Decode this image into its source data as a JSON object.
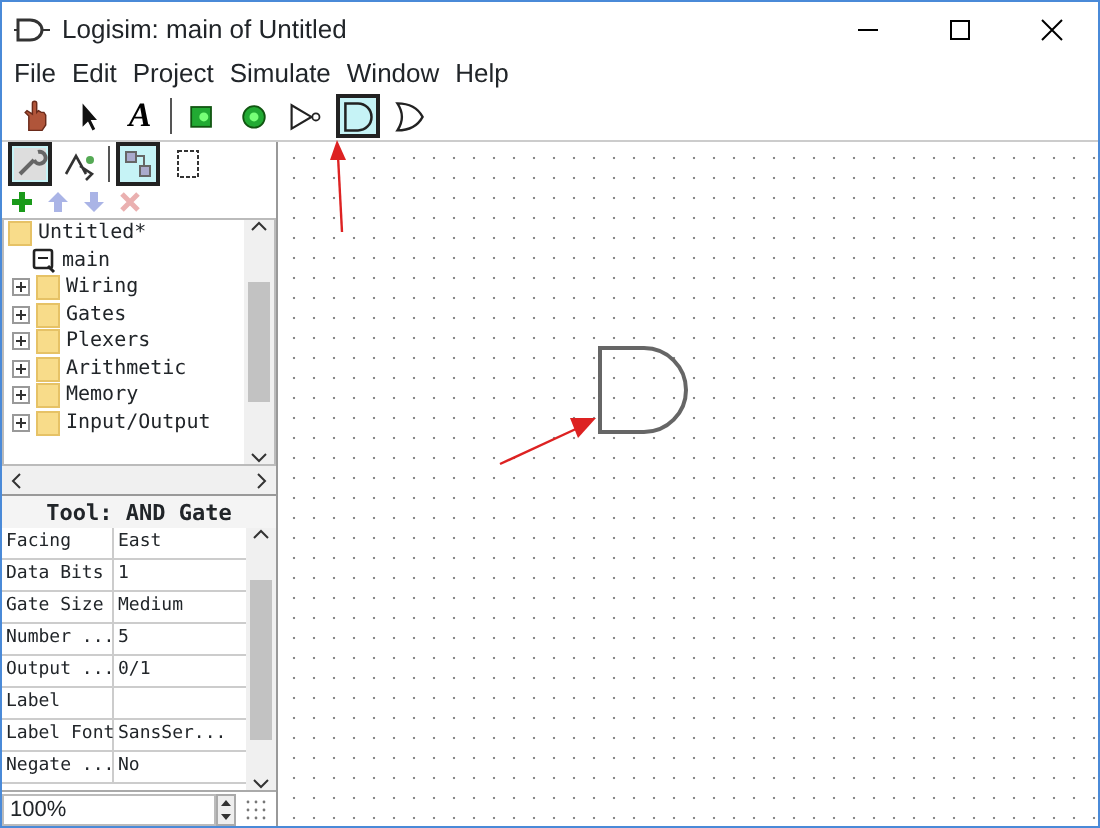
{
  "window": {
    "title": "Logisim: main of Untitled"
  },
  "menu": [
    "File",
    "Edit",
    "Project",
    "Simulate",
    "Window",
    "Help"
  ],
  "toolbar": [
    {
      "kind": "poke",
      "selected": false
    },
    {
      "kind": "select",
      "selected": false
    },
    {
      "kind": "text",
      "label": "A",
      "selected": false
    },
    {
      "kind": "sep"
    },
    {
      "kind": "pin-in",
      "selected": false
    },
    {
      "kind": "pin-out",
      "selected": false
    },
    {
      "kind": "not",
      "selected": false
    },
    {
      "kind": "and",
      "selected": true
    },
    {
      "kind": "or",
      "selected": false
    }
  ],
  "view_buttons": [
    {
      "kind": "wrench",
      "selected": true
    },
    {
      "kind": "shapes",
      "selected": false
    },
    {
      "kind": "sep"
    },
    {
      "kind": "layout",
      "selected": true
    },
    {
      "kind": "frame",
      "selected": false
    }
  ],
  "project_buttons": [
    {
      "kind": "add",
      "disabled": false
    },
    {
      "kind": "up",
      "disabled": true
    },
    {
      "kind": "down",
      "disabled": true
    },
    {
      "kind": "remove",
      "disabled": true
    }
  ],
  "tree": [
    {
      "label": "Untitled*",
      "kind": "project",
      "expanded": true,
      "children": [
        {
          "label": "main",
          "kind": "circuit"
        },
        {
          "label": "Wiring",
          "kind": "library",
          "expanded": false
        },
        {
          "label": "Gates",
          "kind": "library",
          "expanded": false
        },
        {
          "label": "Plexers",
          "kind": "library",
          "expanded": false
        },
        {
          "label": "Arithmetic",
          "kind": "library",
          "expanded": false
        },
        {
          "label": "Memory",
          "kind": "library",
          "expanded": false
        },
        {
          "label": "Input/Output",
          "kind": "library",
          "expanded": false
        }
      ]
    }
  ],
  "properties": {
    "title": "Tool: AND Gate",
    "rows": [
      [
        "Facing",
        "East"
      ],
      [
        "Data Bits",
        "1"
      ],
      [
        "Gate Size",
        "Medium"
      ],
      [
        "Number ...",
        "5"
      ],
      [
        "Output ...",
        "0/1"
      ],
      [
        "Label",
        ""
      ],
      [
        "Label Font",
        "SansSer..."
      ],
      [
        "Negate ...",
        "No"
      ]
    ]
  },
  "zoom": "100%",
  "canvas": {
    "components": [
      {
        "kind": "and"
      }
    ]
  }
}
